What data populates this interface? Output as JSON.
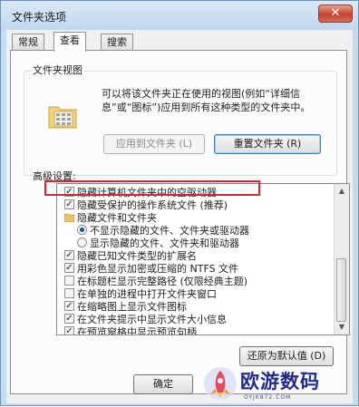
{
  "window": {
    "title": "文件夹选项",
    "close_glyph": "✕"
  },
  "tabs": [
    {
      "label": "常规"
    },
    {
      "label": "查看",
      "active": true
    },
    {
      "label": "搜索"
    }
  ],
  "folder_views": {
    "title": "文件夹视图",
    "description": "可以将该文件夹正在使用的视图(例如“详细信息”或“图标”)应用到所有这种类型的文件夹中。",
    "apply_button": "应用到文件夹 (L)",
    "reset_button": "重置文件夹 (R)"
  },
  "advanced": {
    "label": "高级设置:",
    "items": [
      {
        "kind": "checkbox",
        "checked": true,
        "text": "隐藏计算机文件夹中的空驱动器"
      },
      {
        "kind": "checkbox",
        "checked": true,
        "text": "隐藏受保护的操作系统文件 (推荐)"
      },
      {
        "kind": "folder",
        "text": "隐藏文件和文件夹"
      },
      {
        "kind": "radio",
        "checked": true,
        "text": "不显示隐藏的文件、文件夹或驱动器"
      },
      {
        "kind": "radio",
        "checked": false,
        "text": "显示隐藏的文件、文件夹和驱动器"
      },
      {
        "kind": "checkbox",
        "checked": true,
        "text": "隐藏已知文件类型的扩展名"
      },
      {
        "kind": "checkbox",
        "checked": true,
        "text": "用彩色显示加密或压缩的 NTFS 文件"
      },
      {
        "kind": "checkbox",
        "checked": false,
        "text": "在标题栏显示完整路径 (仅限经典主题)"
      },
      {
        "kind": "checkbox",
        "checked": false,
        "text": "在单独的进程中打开文件夹窗口"
      },
      {
        "kind": "checkbox",
        "checked": true,
        "text": "在缩略图上显示文件图标"
      },
      {
        "kind": "checkbox",
        "checked": true,
        "text": "在文件夹提示中显示文件大小信息"
      },
      {
        "kind": "checkbox",
        "checked": true,
        "text": "在预览窗格中显示预览句柄"
      }
    ],
    "restore_button": "还原为默认值 (D)"
  },
  "footer": {
    "ok_button": "确定"
  },
  "watermark": {
    "text": "欧游数码",
    "sub": "OYJK872.COM"
  },
  "colors": {
    "highlight_box": "#d9262e",
    "titlebar": "#c5dbf1",
    "watermark": "#232a8e"
  }
}
